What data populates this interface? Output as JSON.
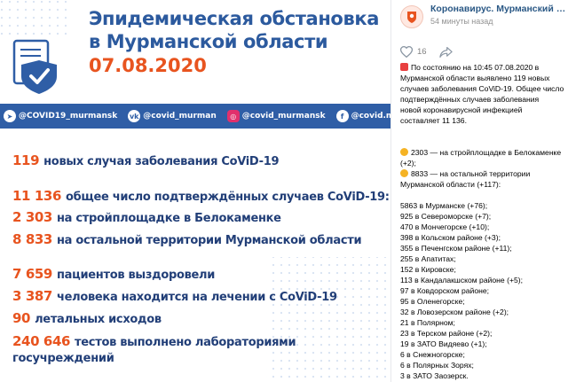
{
  "poster": {
    "title_line1": "Эпидемическая обстановка",
    "title_line2": "в Мурманской области",
    "date": "07.08.2020",
    "socials": [
      {
        "icon": "telegram-icon",
        "label": "@COVID19_murmansk"
      },
      {
        "icon": "vk-icon",
        "label": "@covid_murman"
      },
      {
        "icon": "instagram-icon",
        "label": "@covid_murmansk"
      },
      {
        "icon": "facebook-icon",
        "label": "@covid.murman"
      }
    ],
    "stats": [
      {
        "num": "119",
        "text": "новых случая заболевания CoViD-19"
      },
      {
        "num": "11 136",
        "text": "общее число подтверждённых случаев CoViD-19:"
      },
      {
        "num": "2 303",
        "text": "на стройплощадке в Белокаменке"
      },
      {
        "num": "8 833",
        "text": "на остальной территории Мурманской области"
      },
      {
        "num": "7 659",
        "text": "пациентов выздоровели"
      },
      {
        "num": "3 387",
        "text": "человека находится на лечении с CoViD-19"
      },
      {
        "num": "90",
        "text": "летальных исходов"
      },
      {
        "num": "240 646",
        "text": "тестов выполнено лабораториями",
        "text2": "госучреждений"
      }
    ],
    "colors": {
      "blue": "#2c5a9e",
      "orange": "#e8541f",
      "bar": "#2f5ea6"
    }
  },
  "post": {
    "community": "Коронавирус. Мурманский оперативный штаб",
    "time": "54 минуты назад",
    "likes": "16",
    "intro": [
      "По состоянию на 10:45 07.08.2020 в",
      "Мурманской области выявлено 119 новых",
      "случаев заболевания CoViD-19. Общее число",
      "подтверждённых случаев заболевания",
      "новой коронавирусной инфекцией",
      "составляет 11 136."
    ],
    "b1_l1": "2303 — на стройплощадке в Белокаменке",
    "b1_l2": "(+2);",
    "b2_l1": "8833 — на остальной территории",
    "b2_l2": "Мурманской области (+117):",
    "districts": [
      "5863 в Мурманске (+76);",
      "925 в Североморске (+7);",
      "470 в Мончегорске (+10);",
      "398 в Кольском районе (+3);",
      "355 в Печенгском районе (+11);",
      "255 в Апатитах;",
      "152 в Кировске;",
      "113 в Кандалакшском районе (+5);",
      "97 в Ковдорском районе;",
      "95 в Оленегорске;",
      "32 в Ловозерском районе (+2);",
      "21 в Полярном;",
      "23 в Терском районе (+2);",
      "19 в ЗАТО Видяево (+1);",
      "6 в Снежногорске;",
      "6 в Полярных Зорях;",
      "3 в ЗАТО Заозерск."
    ]
  }
}
